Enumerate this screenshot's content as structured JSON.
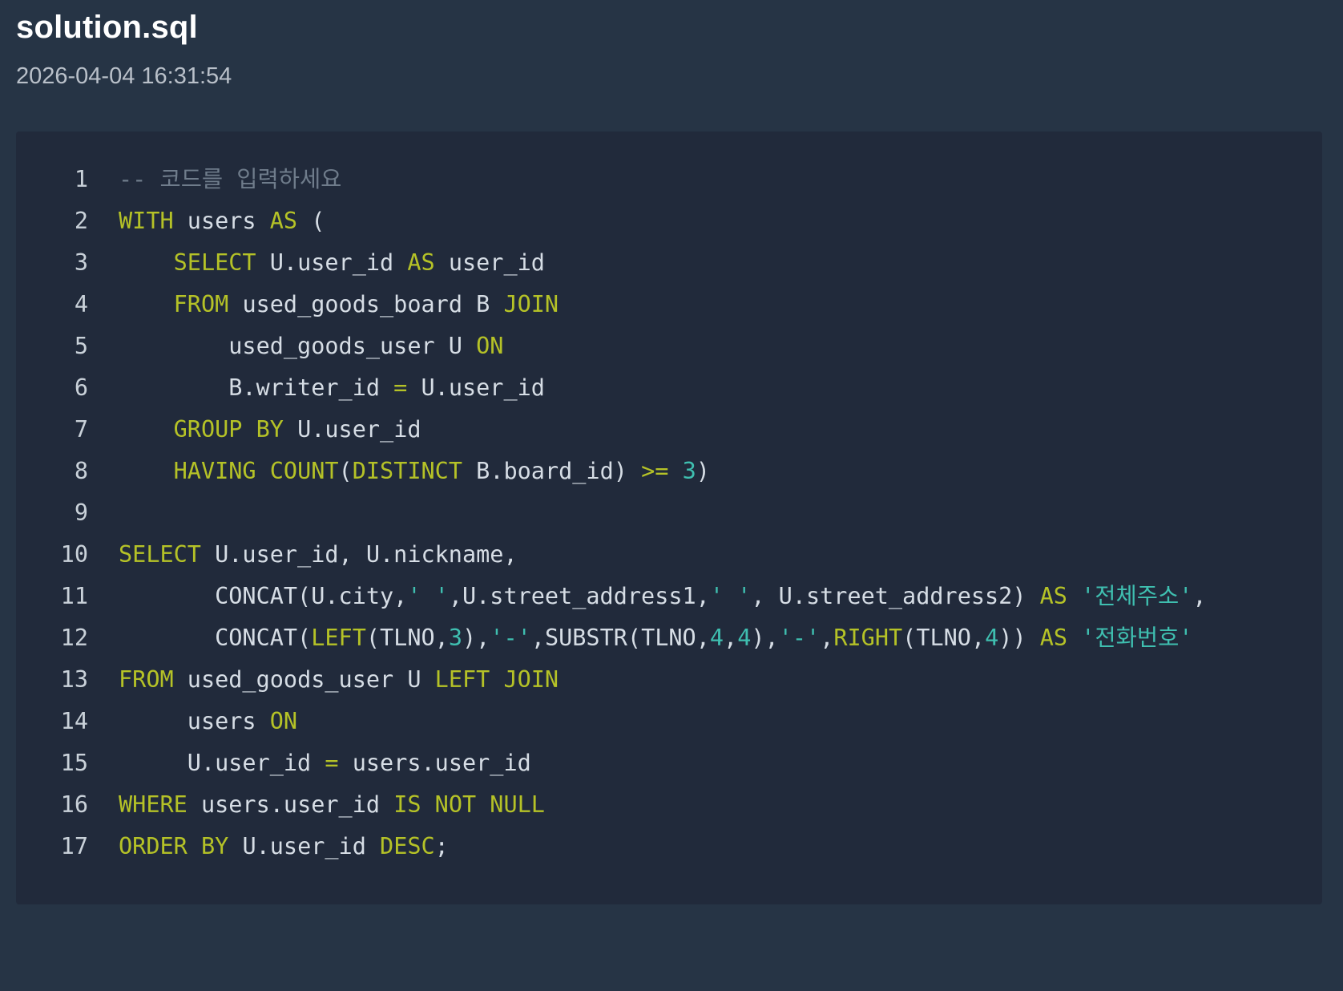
{
  "header": {
    "filename": "solution.sql",
    "timestamp": "2026-04-04 16:31:54"
  },
  "colors": {
    "background": "#263445",
    "code_panel": "#212a3b",
    "keyword": "#b5c227",
    "number_string": "#3fbfb0",
    "comment": "#6f7c8b",
    "text": "#d6dde5"
  },
  "code": {
    "language": "sql",
    "lines": [
      {
        "num": "1",
        "tokens": [
          {
            "t": "cmt",
            "v": "-- 코드를 입력하세요"
          }
        ]
      },
      {
        "num": "2",
        "tokens": [
          {
            "t": "kw",
            "v": "WITH"
          },
          {
            "t": "txt",
            "v": " users "
          },
          {
            "t": "kw",
            "v": "AS"
          },
          {
            "t": "txt",
            "v": " ("
          }
        ]
      },
      {
        "num": "3",
        "tokens": [
          {
            "t": "txt",
            "v": "    "
          },
          {
            "t": "kw",
            "v": "SELECT"
          },
          {
            "t": "txt",
            "v": " U.user_id "
          },
          {
            "t": "kw",
            "v": "AS"
          },
          {
            "t": "txt",
            "v": " user_id"
          }
        ]
      },
      {
        "num": "4",
        "tokens": [
          {
            "t": "txt",
            "v": "    "
          },
          {
            "t": "kw",
            "v": "FROM"
          },
          {
            "t": "txt",
            "v": " used_goods_board B "
          },
          {
            "t": "kw",
            "v": "JOIN"
          }
        ]
      },
      {
        "num": "5",
        "tokens": [
          {
            "t": "txt",
            "v": "        used_goods_user U "
          },
          {
            "t": "kw",
            "v": "ON"
          }
        ]
      },
      {
        "num": "6",
        "tokens": [
          {
            "t": "txt",
            "v": "        B.writer_id "
          },
          {
            "t": "kw",
            "v": "="
          },
          {
            "t": "txt",
            "v": " U.user_id"
          }
        ]
      },
      {
        "num": "7",
        "tokens": [
          {
            "t": "txt",
            "v": "    "
          },
          {
            "t": "kw",
            "v": "GROUP BY"
          },
          {
            "t": "txt",
            "v": " U.user_id"
          }
        ]
      },
      {
        "num": "8",
        "tokens": [
          {
            "t": "txt",
            "v": "    "
          },
          {
            "t": "kw",
            "v": "HAVING COUNT"
          },
          {
            "t": "txt",
            "v": "("
          },
          {
            "t": "kw",
            "v": "DISTINCT"
          },
          {
            "t": "txt",
            "v": " B.board_id) "
          },
          {
            "t": "kw",
            "v": ">="
          },
          {
            "t": "txt",
            "v": " "
          },
          {
            "t": "num",
            "v": "3"
          },
          {
            "t": "txt",
            "v": ")"
          }
        ]
      },
      {
        "num": "9",
        "tokens": []
      },
      {
        "num": "10",
        "tokens": [
          {
            "t": "kw",
            "v": "SELECT"
          },
          {
            "t": "txt",
            "v": " U.user_id, U.nickname,"
          }
        ]
      },
      {
        "num": "11",
        "tokens": [
          {
            "t": "txt",
            "v": "       CONCAT(U.city,"
          },
          {
            "t": "str",
            "v": "' '"
          },
          {
            "t": "txt",
            "v": ",U.street_address1,"
          },
          {
            "t": "str",
            "v": "' '"
          },
          {
            "t": "txt",
            "v": ", U.street_address2) "
          },
          {
            "t": "kw",
            "v": "AS"
          },
          {
            "t": "txt",
            "v": " "
          },
          {
            "t": "str",
            "v": "'전체주소'"
          },
          {
            "t": "txt",
            "v": ","
          }
        ]
      },
      {
        "num": "12",
        "tokens": [
          {
            "t": "txt",
            "v": "       CONCAT("
          },
          {
            "t": "kw",
            "v": "LEFT"
          },
          {
            "t": "txt",
            "v": "(TLNO,"
          },
          {
            "t": "num",
            "v": "3"
          },
          {
            "t": "txt",
            "v": "),"
          },
          {
            "t": "str",
            "v": "'-'"
          },
          {
            "t": "txt",
            "v": ",SUBSTR(TLNO,"
          },
          {
            "t": "num",
            "v": "4"
          },
          {
            "t": "txt",
            "v": ","
          },
          {
            "t": "num",
            "v": "4"
          },
          {
            "t": "txt",
            "v": "),"
          },
          {
            "t": "str",
            "v": "'-'"
          },
          {
            "t": "txt",
            "v": ","
          },
          {
            "t": "kw",
            "v": "RIGHT"
          },
          {
            "t": "txt",
            "v": "(TLNO,"
          },
          {
            "t": "num",
            "v": "4"
          },
          {
            "t": "txt",
            "v": ")) "
          },
          {
            "t": "kw",
            "v": "AS"
          },
          {
            "t": "txt",
            "v": " "
          },
          {
            "t": "str",
            "v": "'전화번호'"
          }
        ]
      },
      {
        "num": "13",
        "tokens": [
          {
            "t": "kw",
            "v": "FROM"
          },
          {
            "t": "txt",
            "v": " used_goods_user U "
          },
          {
            "t": "kw",
            "v": "LEFT JOIN"
          }
        ]
      },
      {
        "num": "14",
        "tokens": [
          {
            "t": "txt",
            "v": "     users "
          },
          {
            "t": "kw",
            "v": "ON"
          }
        ]
      },
      {
        "num": "15",
        "tokens": [
          {
            "t": "txt",
            "v": "     U.user_id "
          },
          {
            "t": "kw",
            "v": "="
          },
          {
            "t": "txt",
            "v": " users.user_id"
          }
        ]
      },
      {
        "num": "16",
        "tokens": [
          {
            "t": "kw",
            "v": "WHERE"
          },
          {
            "t": "txt",
            "v": " users.user_id "
          },
          {
            "t": "kw",
            "v": "IS NOT NULL"
          }
        ]
      },
      {
        "num": "17",
        "tokens": [
          {
            "t": "kw",
            "v": "ORDER BY"
          },
          {
            "t": "txt",
            "v": " U.user_id "
          },
          {
            "t": "kw",
            "v": "DESC"
          },
          {
            "t": "txt",
            "v": ";"
          }
        ]
      }
    ]
  }
}
